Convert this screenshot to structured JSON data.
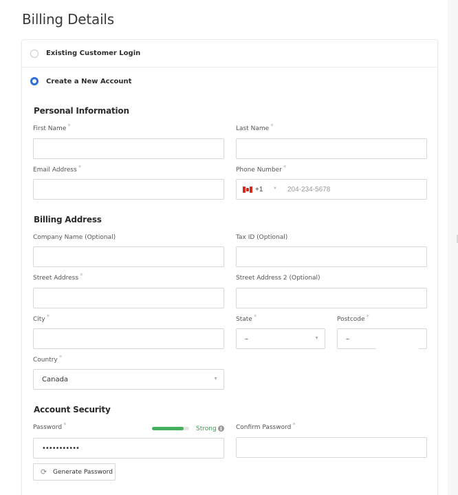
{
  "page": {
    "title": "Billing Details"
  },
  "account_options": {
    "existing": {
      "label": "Existing Customer Login",
      "selected": false
    },
    "create": {
      "label": "Create a New Account",
      "selected": true
    }
  },
  "sections": {
    "personal": "Personal Information",
    "billing": "Billing Address",
    "security": "Account Security"
  },
  "fields": {
    "first_name": {
      "label": "First Name",
      "required": "*",
      "value": ""
    },
    "last_name": {
      "label": "Last Name",
      "required": "*",
      "value": ""
    },
    "email": {
      "label": "Email Address",
      "required": "*",
      "value": ""
    },
    "phone": {
      "label": "Phone Number",
      "required": "*",
      "dial_code": "+1",
      "country_flag": "canada-flag-icon",
      "placeholder": "204-234-5678",
      "value": ""
    },
    "company": {
      "label": "Company Name (Optional)",
      "value": ""
    },
    "tax_id": {
      "label": "Tax ID (Optional)",
      "value": ""
    },
    "street": {
      "label": "Street Address",
      "required": "*",
      "value": ""
    },
    "street2": {
      "label": "Street Address 2 (Optional)",
      "value": ""
    },
    "city": {
      "label": "City",
      "required": "*",
      "value": ""
    },
    "state": {
      "label": "State",
      "required": "*",
      "value": "–"
    },
    "postcode": {
      "label": "Postcode",
      "required": "*",
      "value": "–"
    },
    "country": {
      "label": "Country",
      "required": "*",
      "value": "Canada"
    },
    "password": {
      "label": "Password",
      "required": "*",
      "value": "•••••••••••"
    },
    "confirm_password": {
      "label": "Confirm Password",
      "required": "*",
      "value": ""
    }
  },
  "password_strength": {
    "label": "Strong",
    "level": 0.85,
    "color": "#43b05c"
  },
  "generate_password": {
    "label": "Generate Password",
    "icon": "refresh-icon"
  },
  "colors": {
    "accent": "#2f6fd6",
    "strong": "#3a9a4d"
  }
}
